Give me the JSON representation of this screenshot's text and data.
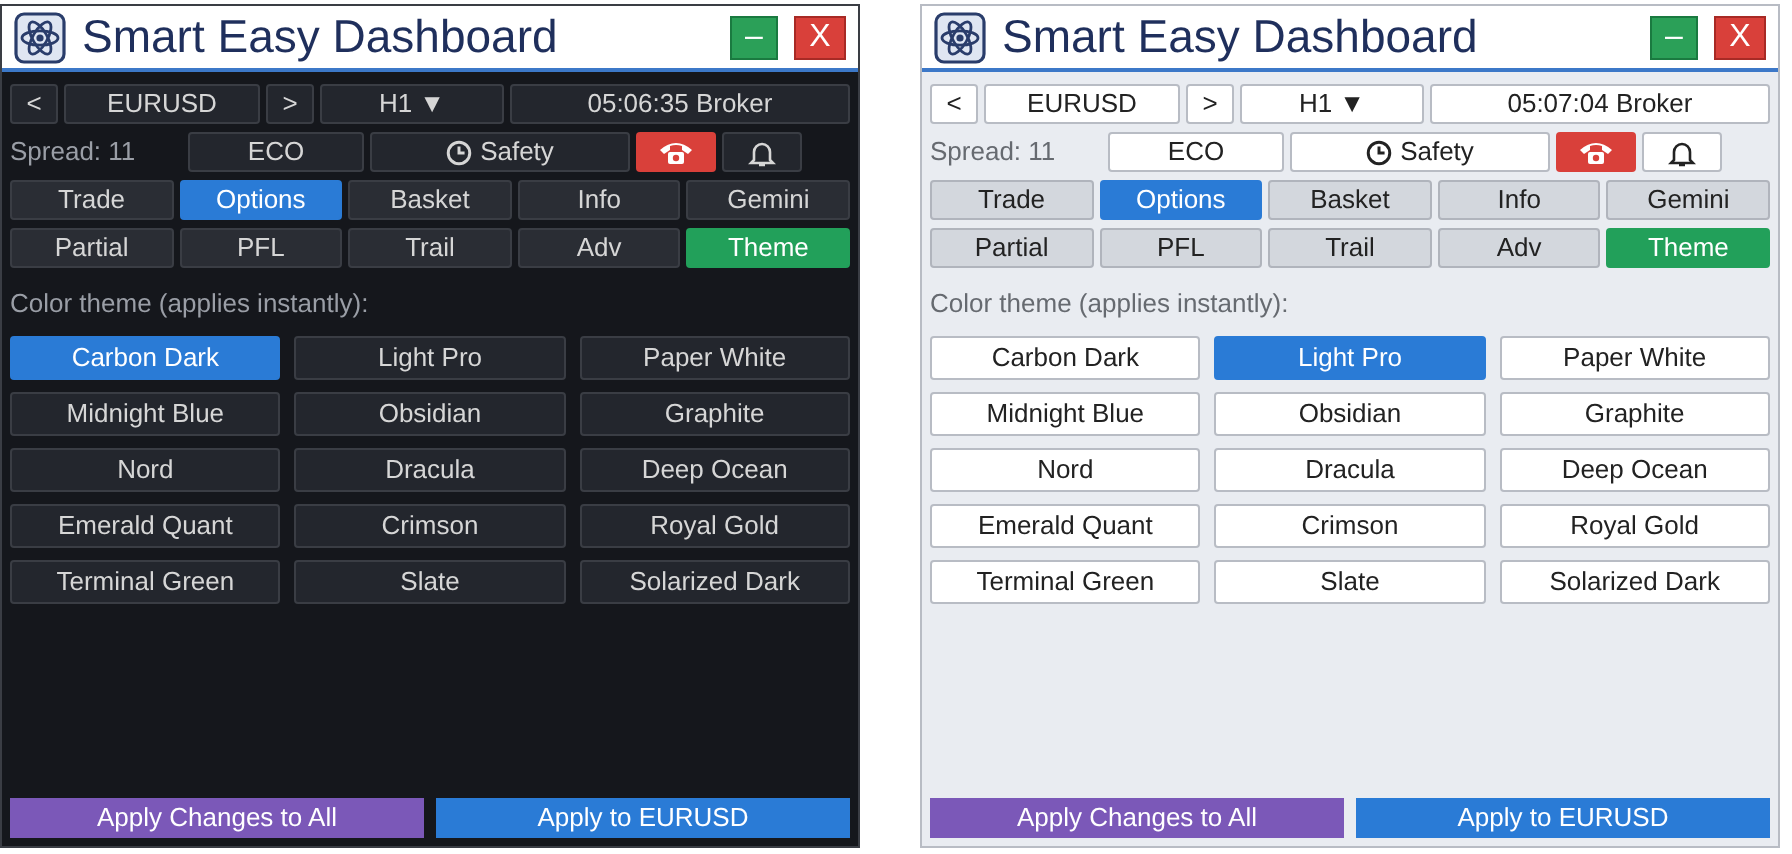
{
  "panels": [
    {
      "kind": "dark",
      "title": "Smart Easy Dashboard",
      "minimize": "–",
      "close": "X",
      "nav": {
        "prev": "<",
        "symbol": "EURUSD",
        "next": ">",
        "timeframe": "H1 ▼",
        "clock": "05:06:35 Broker"
      },
      "spread": "Spread: 11",
      "eco": "ECO",
      "safety": "Safety",
      "tab_rows": [
        {
          "kind": "main",
          "tabs": [
            {
              "label": "Trade",
              "selected": false
            },
            {
              "label": "Options",
              "selected": true
            },
            {
              "label": "Basket",
              "selected": false
            },
            {
              "label": "Info",
              "selected": false
            },
            {
              "label": "Gemini",
              "selected": false
            }
          ]
        },
        {
          "kind": "sub",
          "tabs": [
            {
              "label": "Partial",
              "selected": false
            },
            {
              "label": "PFL",
              "selected": false
            },
            {
              "label": "Trail",
              "selected": false
            },
            {
              "label": "Adv",
              "selected": false
            },
            {
              "label": "Theme",
              "selected": true
            }
          ]
        }
      ],
      "theme_label": "Color theme (applies instantly):",
      "themes": [
        {
          "label": "Carbon Dark",
          "selected": true
        },
        {
          "label": "Light Pro",
          "selected": false
        },
        {
          "label": "Paper White",
          "selected": false
        },
        {
          "label": "Midnight Blue",
          "selected": false
        },
        {
          "label": "Obsidian",
          "selected": false
        },
        {
          "label": "Graphite",
          "selected": false
        },
        {
          "label": "Nord",
          "selected": false
        },
        {
          "label": "Dracula",
          "selected": false
        },
        {
          "label": "Deep Ocean",
          "selected": false
        },
        {
          "label": "Emerald Quant",
          "selected": false
        },
        {
          "label": "Crimson",
          "selected": false
        },
        {
          "label": "Royal Gold",
          "selected": false
        },
        {
          "label": "Terminal Green",
          "selected": false
        },
        {
          "label": "Slate",
          "selected": false
        },
        {
          "label": "Solarized Dark",
          "selected": false
        }
      ],
      "apply_all": "Apply Changes to All",
      "apply_symbol": "Apply to EURUSD"
    },
    {
      "kind": "light",
      "title": "Smart Easy Dashboard",
      "minimize": "–",
      "close": "X",
      "nav": {
        "prev": "<",
        "symbol": "EURUSD",
        "next": ">",
        "timeframe": "H1 ▼",
        "clock": "05:07:04 Broker"
      },
      "spread": "Spread: 11",
      "eco": "ECO",
      "safety": "Safety",
      "tab_rows": [
        {
          "kind": "main",
          "tabs": [
            {
              "label": "Trade",
              "selected": false
            },
            {
              "label": "Options",
              "selected": true
            },
            {
              "label": "Basket",
              "selected": false
            },
            {
              "label": "Info",
              "selected": false
            },
            {
              "label": "Gemini",
              "selected": false
            }
          ]
        },
        {
          "kind": "sub",
          "tabs": [
            {
              "label": "Partial",
              "selected": false
            },
            {
              "label": "PFL",
              "selected": false
            },
            {
              "label": "Trail",
              "selected": false
            },
            {
              "label": "Adv",
              "selected": false
            },
            {
              "label": "Theme",
              "selected": true
            }
          ]
        }
      ],
      "theme_label": "Color theme (applies instantly):",
      "themes": [
        {
          "label": "Carbon Dark",
          "selected": false
        },
        {
          "label": "Light Pro",
          "selected": true
        },
        {
          "label": "Paper White",
          "selected": false
        },
        {
          "label": "Midnight Blue",
          "selected": false
        },
        {
          "label": "Obsidian",
          "selected": false
        },
        {
          "label": "Graphite",
          "selected": false
        },
        {
          "label": "Nord",
          "selected": false
        },
        {
          "label": "Dracula",
          "selected": false
        },
        {
          "label": "Deep Ocean",
          "selected": false
        },
        {
          "label": "Emerald Quant",
          "selected": false
        },
        {
          "label": "Crimson",
          "selected": false
        },
        {
          "label": "Royal Gold",
          "selected": false
        },
        {
          "label": "Terminal Green",
          "selected": false
        },
        {
          "label": "Slate",
          "selected": false
        },
        {
          "label": "Solarized Dark",
          "selected": false
        }
      ],
      "apply_all": "Apply Changes to All",
      "apply_symbol": "Apply to EURUSD"
    }
  ]
}
